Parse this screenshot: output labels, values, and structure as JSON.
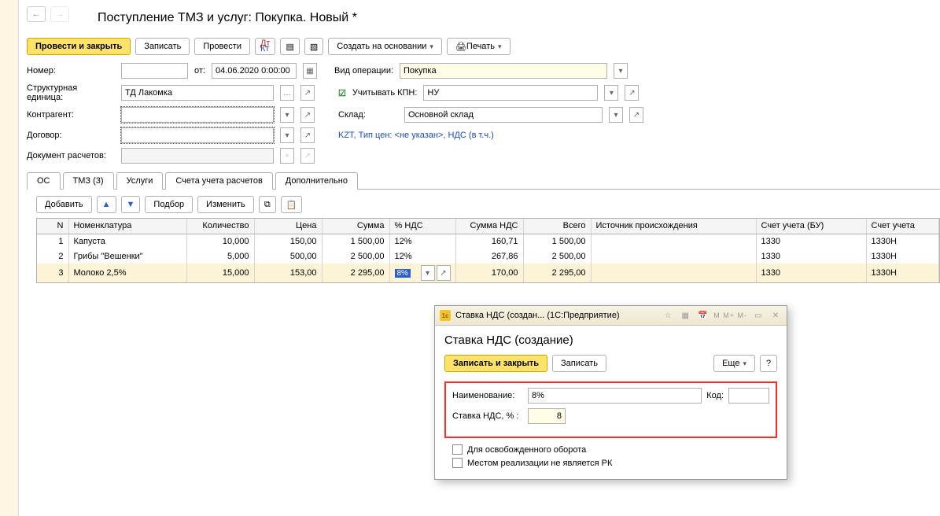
{
  "header": {
    "title": "Поступление ТМЗ и услуг: Покупка. Новый *"
  },
  "toolbar": {
    "post_and_close": "Провести и закрыть",
    "save": "Записать",
    "post": "Провести",
    "create_based": "Создать на основании",
    "print": "Печать"
  },
  "form": {
    "number_label": "Номер:",
    "number": "",
    "from_label": "от:",
    "date": "04.06.2020 0:00:00",
    "op_type_label": "Вид операции:",
    "op_type": "Покупка",
    "unit_label": "Структурная единица:",
    "unit": "ТД Лакомка",
    "kpn_label": "Учитывать КПН:",
    "kpn_value": "НУ",
    "counterparty_label": "Контрагент:",
    "counterparty": "",
    "warehouse_label": "Склад:",
    "warehouse": "Основной склад",
    "contract_label": "Договор:",
    "contract": "",
    "info_link": "KZT, Тип цен: <не указан>, НДС (в т.ч.)",
    "settlement_doc_label": "Документ расчетов:"
  },
  "tabs": {
    "os": "ОС",
    "tms": "ТМЗ (3)",
    "services": "Услуги",
    "accounts": "Счета учета расчетов",
    "additional": "Дополнительно"
  },
  "subtb": {
    "add": "Добавить",
    "pick": "Подбор",
    "change": "Изменить"
  },
  "columns": {
    "n": "N",
    "item": "Номенклатура",
    "qty": "Количество",
    "price": "Цена",
    "sum": "Сумма",
    "vat_pct": "% НДС",
    "vat_sum": "Сумма НДС",
    "total": "Всего",
    "origin": "Источник происхождения",
    "acc_bu": "Счет учета (БУ)",
    "acc_nu": "Счет учета"
  },
  "rows": [
    {
      "n": "1",
      "item": "Капуста",
      "qty": "10,000",
      "price": "150,00",
      "sum": "1 500,00",
      "vat_pct": "12%",
      "vat_sum": "160,71",
      "total": "1 500,00",
      "acc_bu": "1330",
      "acc_nu": "1330Н"
    },
    {
      "n": "2",
      "item": "Грибы \"Вешенки\"",
      "qty": "5,000",
      "price": "500,00",
      "sum": "2 500,00",
      "vat_pct": "12%",
      "vat_sum": "267,86",
      "total": "2 500,00",
      "acc_bu": "1330",
      "acc_nu": "1330Н"
    },
    {
      "n": "3",
      "item": "Молоко 2,5%",
      "qty": "15,000",
      "price": "153,00",
      "sum": "2 295,00",
      "vat_pct": "8%",
      "vat_sum": "170,00",
      "total": "2 295,00",
      "acc_bu": "1330",
      "acc_nu": "1330Н"
    }
  ],
  "dialog": {
    "win_title": "Ставка НДС (создан... (1С:Предприятие)",
    "heading": "Ставка НДС (создание)",
    "save_close": "Записать и закрыть",
    "save": "Записать",
    "more": "Еще",
    "name_label": "Наименование:",
    "name": "8%",
    "code_label": "Код:",
    "code": "",
    "rate_label": "Ставка НДС, % :",
    "rate": "8",
    "chk1": "Для освобожденного оборота",
    "chk2": "Местом реализации не является РК",
    "calc_icons": "M M+ M-"
  }
}
